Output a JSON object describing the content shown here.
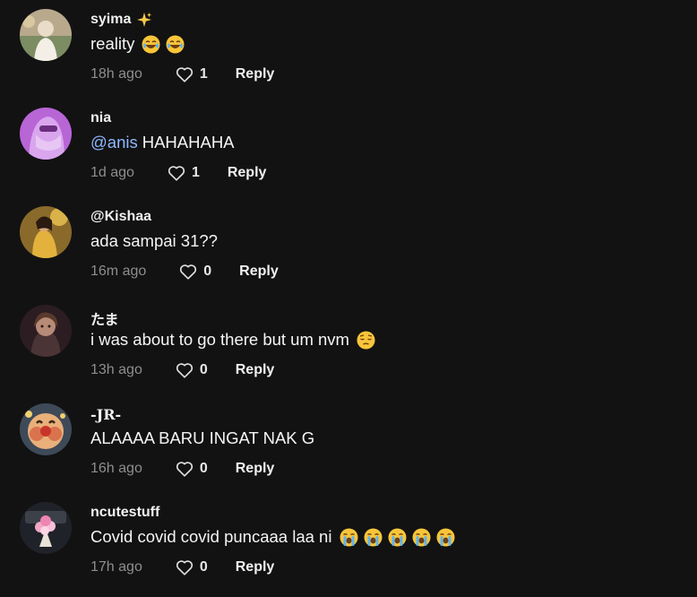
{
  "comments": [
    {
      "username": "syima",
      "username_icon": "sparkles-icon",
      "text": "reality",
      "emojis": [
        "laughing-face-emoji",
        "laughing-face-emoji"
      ],
      "time": "18h ago",
      "likes": "1",
      "reply_label": "Reply"
    },
    {
      "username": "nia",
      "mention": "@anis",
      "text": "HAHAHAHA",
      "time": "1d ago",
      "likes": "1",
      "reply_label": "Reply"
    },
    {
      "username": "@Kishaa",
      "text": "ada sampai 31??",
      "time": "16m ago",
      "likes": "0",
      "reply_label": "Reply"
    },
    {
      "username": "たま",
      "text": "i was about to go there but um nvm",
      "emojis": [
        "pensive-face-emoji"
      ],
      "time": "13h ago",
      "likes": "0",
      "reply_label": "Reply"
    },
    {
      "username": "-JR-",
      "text": "ALAAAA BARU INGAT NAK G",
      "time": "16h ago",
      "likes": "0",
      "reply_label": "Reply"
    },
    {
      "username": "ncutestuff",
      "text": "Covid covid covid puncaaa laa ni",
      "emojis": [
        "crying-face-emoji",
        "crying-face-emoji",
        "crying-face-emoji",
        "crying-face-emoji",
        "crying-face-emoji"
      ],
      "time": "17h ago",
      "likes": "0",
      "reply_label": "Reply"
    }
  ],
  "colors": {
    "background": "#121212",
    "mention": "#8fb8ff",
    "muted_text": "#8e8e8e",
    "primary_text": "#f1f1f1"
  }
}
